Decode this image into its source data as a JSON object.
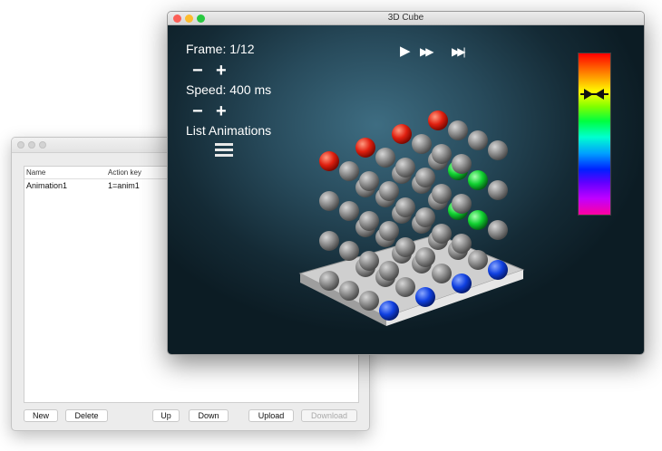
{
  "list_window": {
    "columns": [
      "Name",
      "Action key"
    ],
    "rows": [
      {
        "name": "Animation1",
        "action_key": "1=anim1"
      }
    ],
    "buttons": {
      "new": "New",
      "delete": "Delete",
      "up": "Up",
      "down": "Down",
      "upload": "Upload",
      "download": "Download"
    }
  },
  "cube_window": {
    "title": "3D Cube",
    "frame_label": "Frame: 1/12",
    "speed_label": "Speed: 400 ms",
    "minus": "−",
    "plus": "+",
    "list_animations": "List Animations",
    "controls": {
      "play": "▶",
      "fast_forward": "▶▶",
      "skip_to_end": "▶▶|"
    },
    "colors": {
      "red": "#e02010",
      "green": "#10d030",
      "blue": "#1040e0",
      "gray": "#8a8a8a"
    }
  }
}
